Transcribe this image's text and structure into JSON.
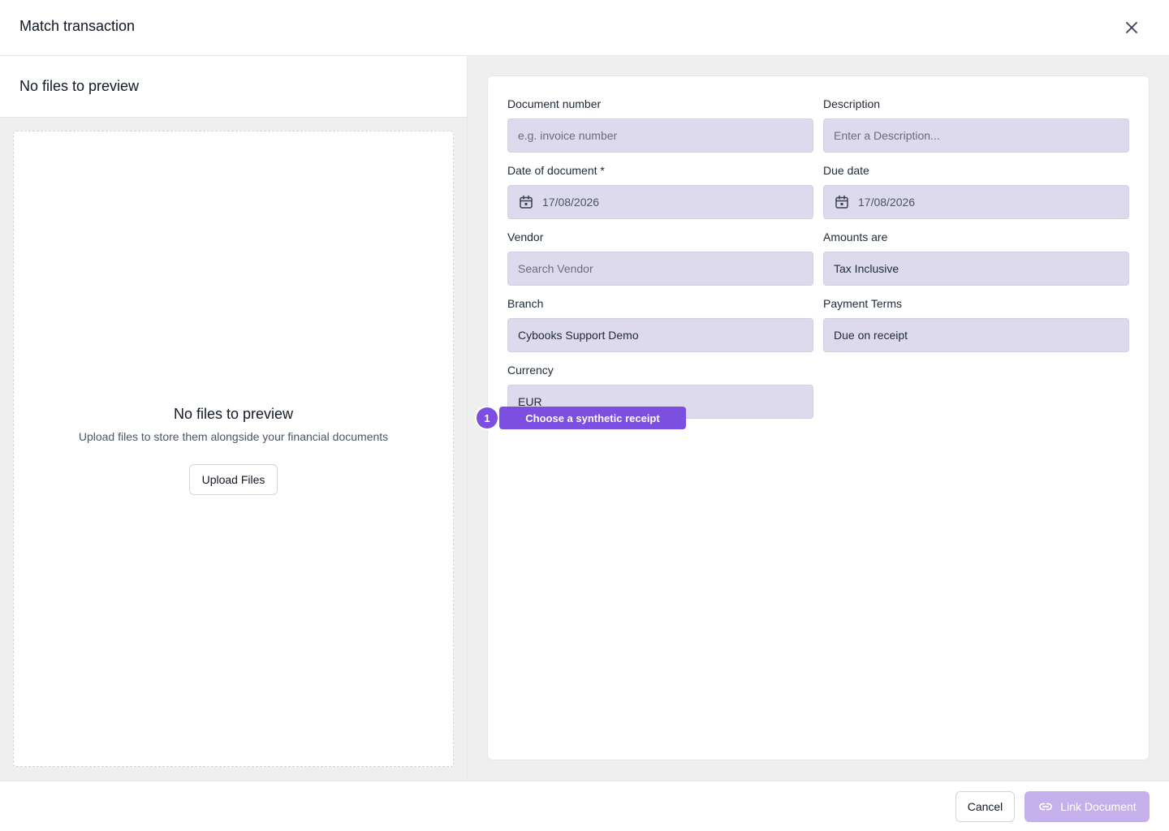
{
  "header": {
    "title": "Match transaction",
    "close_icon": "close-icon"
  },
  "preview": {
    "title": "No files to preview",
    "empty_title": "No files to preview",
    "empty_subtitle": "Upload files to store them alongside your financial documents",
    "upload_label": "Upload Files"
  },
  "form": {
    "document_number": {
      "label": "Document number",
      "placeholder": "e.g. invoice number"
    },
    "description": {
      "label": "Description",
      "placeholder": "Enter a Description..."
    },
    "date_of_document": {
      "label": "Date of document *",
      "value": "17/08/2026",
      "icon": "calendar-icon"
    },
    "due_date": {
      "label": "Due date",
      "value": "17/08/2026",
      "icon": "calendar-icon"
    },
    "vendor": {
      "label": "Vendor",
      "placeholder": "Search Vendor"
    },
    "amounts_are": {
      "label": "Amounts are",
      "value": "Tax Inclusive"
    },
    "branch": {
      "label": "Branch",
      "value": "Cybooks Support Demo"
    },
    "payment_terms": {
      "label": "Payment Terms",
      "value": "Due on receipt"
    },
    "currency": {
      "label": "Currency",
      "value": "EUR"
    }
  },
  "tour": {
    "step": "1",
    "label": "Choose a synthetic receipt"
  },
  "footer": {
    "cancel_label": "Cancel",
    "link_label": "Link Document",
    "link_icon": "link-icon"
  },
  "colors": {
    "accent": "#7c4fe0",
    "accent_disabled": "#c6b0ec",
    "input_bg": "#dcdaec",
    "pane_bg": "#efefef"
  }
}
